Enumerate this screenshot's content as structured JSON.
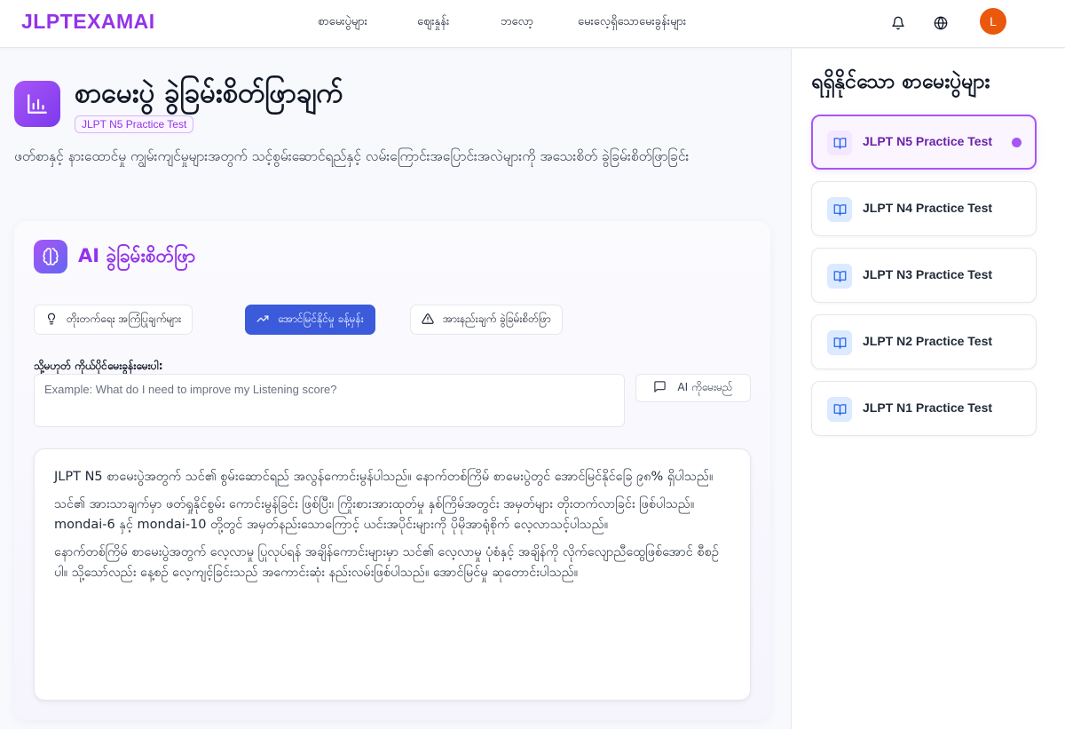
{
  "header": {
    "brand": "JLPTEXAMAI",
    "nav": [
      {
        "label": "စာမေးပွဲများ"
      },
      {
        "label": "ဈေးနှုန်း"
      },
      {
        "label": "ဘလော့"
      },
      {
        "label": "မေးလေ့ရှိသောမေးခွန်းများ"
      }
    ],
    "icons": [
      "bell-icon",
      "globe-icon"
    ],
    "avatar_initial": "L"
  },
  "page": {
    "title": "စာမေးပွဲ ခွဲခြမ်းစိတ်ဖြာချက်",
    "badge": "JLPT N5 Practice Test",
    "description": "ဖတ်စာနှင့် နားထောင်မှု ကျွမ်းကျင်မှုများအတွက် သင့်စွမ်းဆောင်ရည်နှင့် လမ်းကြောင်းအပြောင်းအလဲများကို အသေးစိတ် ခွဲခြမ်းစိတ်ဖြာခြင်း"
  },
  "ai_panel": {
    "title": "AI ခွဲခြမ်းစိတ်ဖြာ",
    "tabs": [
      {
        "label": "တိုးတက်ရေး အကြံပြုချက်များ",
        "icon": "lightbulb-icon",
        "active": false
      },
      {
        "label": "အောင်မြင်နိုင်မှု ခန့်မှန်း",
        "icon": "trending-up-icon",
        "active": true
      },
      {
        "label": "အားနည်းချက် ခွဲခြမ်းစိတ်ဖြာ",
        "icon": "warning-icon",
        "active": false
      }
    ],
    "question_label": "သို့မဟုတ် ကိုယ်ပိုင်မေးခွန်းမေးပါ:",
    "question_placeholder": "Example: What do I need to improve my Listening score?",
    "question_value": "",
    "ask_button": "AI ကိုမေးမည်",
    "answer_paragraphs": [
      "JLPT N5 စာမေးပွဲအတွက် သင်၏ စွမ်းဆောင်ရည် အလွန်ကောင်းမွန်ပါသည်။ နောက်တစ်ကြိမ် စာမေးပွဲတွင် အောင်မြင်နိုင်ခြေ ၉၈% ရှိပါသည်။",
      "သင်၏ အားသာချက်မှာ ဖတ်ရှုနိုင်စွမ်း ကောင်းမွန်ခြင်း ဖြစ်ပြီး၊ ကြိုးစားအားထုတ်မှု နှစ်ကြိမ်အတွင်း အမှတ်များ တိုးတက်လာခြင်း ဖြစ်ပါသည်။ mondai-6 နှင့် mondai-10 တို့တွင် အမှတ်နည်းသောကြောင့် ယင်းအပိုင်းများကို ပိုမိုအာရုံစိုက် လေ့လာသင့်ပါသည်။",
      "နောက်တစ်ကြိမ် စာမေးပွဲအတွက် လေ့လာမှု ပြုလုပ်ရန် အချိန်ကောင်းများမှာ သင်၏ လေ့လာမှု ပုံစံနှင့် အချိန်ကို လိုက်လျောညီထွေဖြစ်အောင် စီစဉ်ပါ။ သို့သော်လည်း နေ့စဉ် လေ့ကျင့်ခြင်းသည် အကောင်းဆုံး နည်းလမ်းဖြစ်ပါသည်။ အောင်မြင်မှု ဆုတောင်းပါသည်။"
    ]
  },
  "sidebar": {
    "title": "ရရှိနိုင်သော စာမေးပွဲများ",
    "tests": [
      {
        "label": "JLPT N5 Practice Test",
        "active": true
      },
      {
        "label": "JLPT N4 Practice Test",
        "active": false
      },
      {
        "label": "JLPT N3 Practice Test",
        "active": false
      },
      {
        "label": "JLPT N2 Practice Test",
        "active": false
      },
      {
        "label": "JLPT N1 Practice Test",
        "active": false
      }
    ]
  },
  "colors": {
    "brand": "#9333ea",
    "active_tab": "#3b5bdb",
    "avatar": "#ea580c"
  }
}
